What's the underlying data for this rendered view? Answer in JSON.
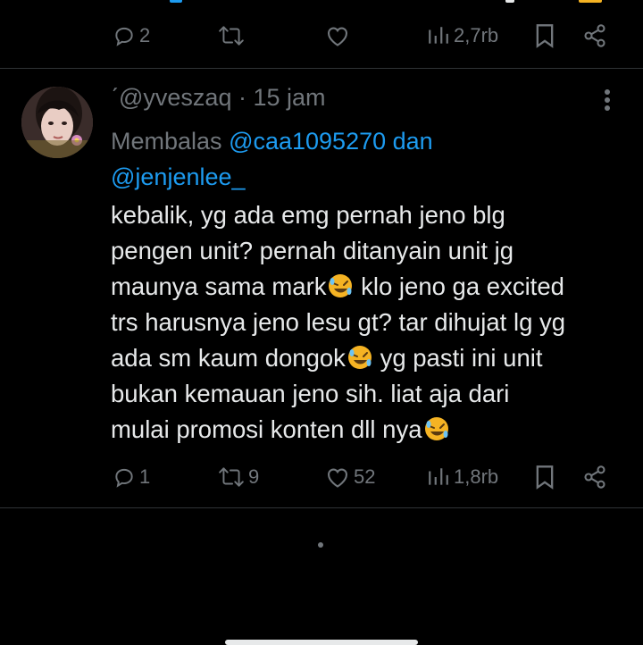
{
  "prev_tweet_actions": {
    "reply_count": "2",
    "retweet_count": "",
    "like_count": "",
    "views": "2,7rb"
  },
  "tweet": {
    "handle": "@yveszaq",
    "separator": "·",
    "time": "15 jam",
    "reply_prefix": "Membalas",
    "reply_to_1": "@caa1095270",
    "reply_conj": "dan",
    "reply_to_2": "@jenjenlee_",
    "body_lines": [
      "kebalik, yg ada emg pernah jeno blg",
      "pengen unit? pernah ditanyain unit jg",
      "maunya sama mark",
      " klo jeno ga excited",
      "trs harusnya jeno lesu gt? tar dihujat lg yg",
      "ada sm kaum dongok",
      " yg pasti ini unit",
      "bukan kemauan jeno sih. liat aja dari",
      "mulai promosi konten dll nya"
    ],
    "actions": {
      "reply_count": "1",
      "retweet_count": "9",
      "like_count": "52",
      "views": "1,8rb"
    }
  },
  "icons": {
    "reply": "reply-icon",
    "retweet": "retweet-icon",
    "like": "heart-icon",
    "views": "views-icon",
    "bookmark": "bookmark-icon",
    "share": "share-icon",
    "more": "more-vertical-icon",
    "emoji": "rolling-on-floor-laughing-emoji"
  },
  "colors": {
    "background": "#000000",
    "text": "#e7e9ea",
    "muted": "#71767b",
    "accent": "#1d9bf0",
    "divider": "#2f3336"
  }
}
